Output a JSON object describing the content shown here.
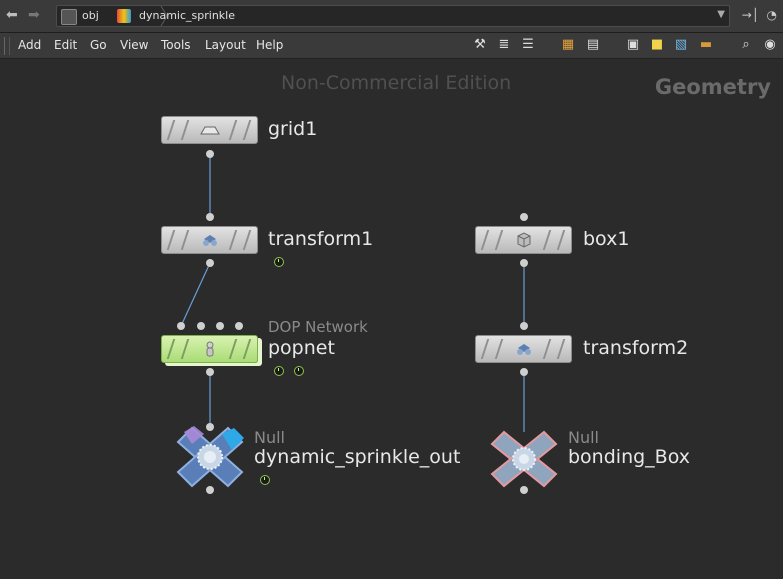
{
  "pathbar": {
    "crumbs": [
      "obj",
      "dynamic_sprinkle"
    ]
  },
  "menu": [
    "Add",
    "Edit",
    "Go",
    "View",
    "Tools",
    "Layout",
    "Help"
  ],
  "watermark": "Non-Commercial Edition",
  "context_label": "Geometry",
  "nodes": {
    "grid1": {
      "name": "grid1"
    },
    "transform1": {
      "name": "transform1"
    },
    "box1": {
      "name": "box1"
    },
    "popnet": {
      "type": "DOP Network",
      "name": "popnet"
    },
    "transform2": {
      "name": "transform2"
    },
    "out": {
      "type": "Null",
      "name": "dynamic_sprinkle_out"
    },
    "bbox": {
      "type": "Null",
      "name": "bonding_Box"
    }
  },
  "colors": {
    "background": "#2b2b2b",
    "node": "#cfcfcf",
    "dop_node": "#b9e68a",
    "null_out": "#5a7fb8",
    "null_bbox": "#8fa5bd",
    "wire": "#6a9ed8"
  }
}
